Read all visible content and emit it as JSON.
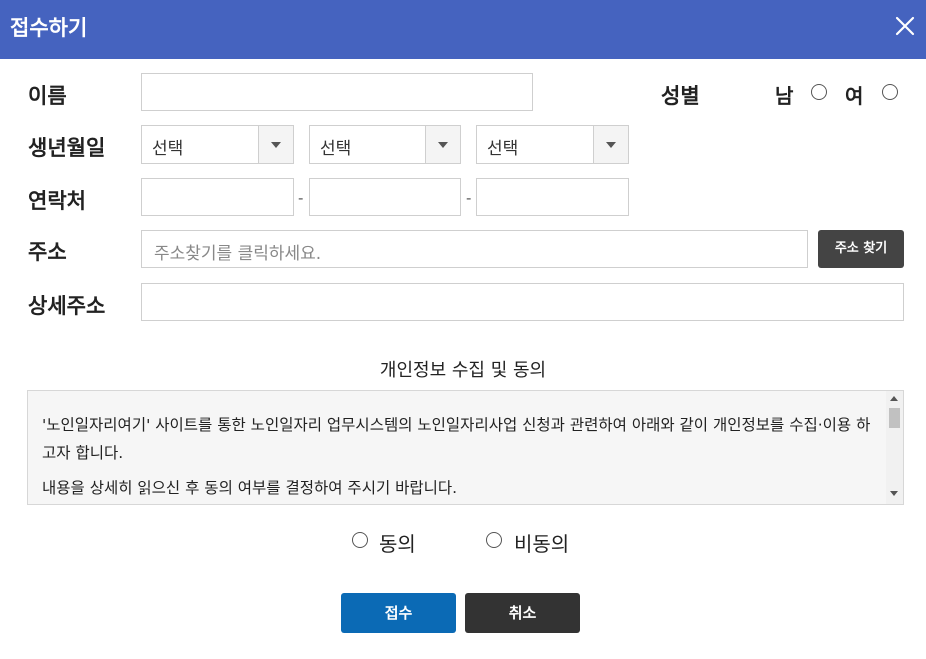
{
  "header": {
    "title": "접수하기"
  },
  "form": {
    "name_label": "이름",
    "gender_label": "성별",
    "gender_male": "남",
    "gender_female": "여",
    "birth_label": "생년월일",
    "birth_year": "선택",
    "birth_month": "선택",
    "birth_day": "선택",
    "phone_label": "연락처",
    "phone_sep1": "-",
    "phone_sep2": "-",
    "address_label": "주소",
    "address_placeholder": "주소찾기를 클릭하세요.",
    "address_button": "주소 찾기",
    "detail_label": "상세주소"
  },
  "consent": {
    "title": "개인정보 수집 및 동의",
    "paragraph1": "'노인일자리여기' 사이트를 통한 노인일자리 업무시스템의 노인일자리사업 신청과 관련하여 아래와 같이 개인정보를 수집·이용 하고자 합니다.",
    "paragraph2": "내용을 상세히 읽으신 후 동의 여부를 결정하여 주시기 바랍니다.",
    "agree": "동의",
    "disagree": "비동의"
  },
  "actions": {
    "submit": "접수",
    "cancel": "취소"
  },
  "colors": {
    "header": "#4563bf",
    "submit": "#0b6ab5",
    "cancel": "#333333",
    "address_button": "#444444"
  }
}
